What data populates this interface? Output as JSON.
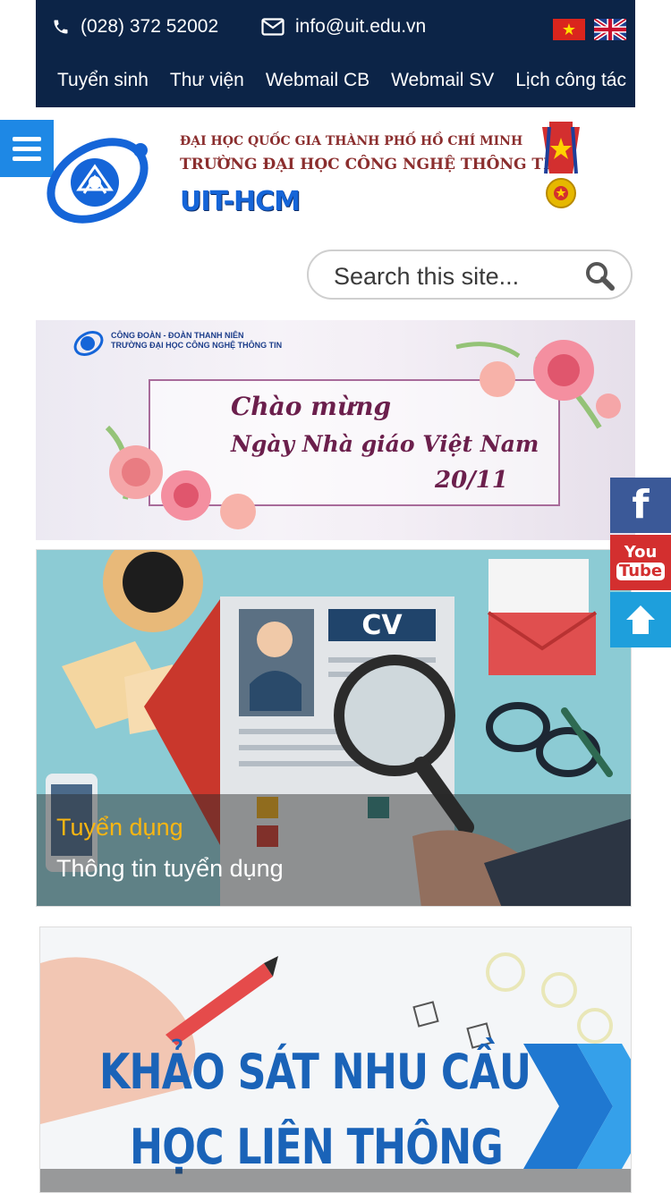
{
  "topbar": {
    "phone": "(028) 372 52002",
    "email": "info@uit.edu.vn",
    "links": [
      "Tuyển sinh",
      "Thư viện",
      "Webmail CB",
      "Webmail SV",
      "Lịch công tác"
    ]
  },
  "header": {
    "line1": "ĐẠI HỌC QUỐC GIA THÀNH PHỐ HỒ CHÍ MINH",
    "line2": "TRƯỜNG ĐẠI HỌC CÔNG NGHỆ THÔNG TIN",
    "line3": "UIT-HCM"
  },
  "search": {
    "placeholder": "Search this site..."
  },
  "banner": {
    "org_line1": "CÔNG ĐOÀN - ĐOÀN THANH NIÊN",
    "org_line2": "TRƯỜNG ĐẠI HỌC CÔNG NGHỆ THÔNG TIN",
    "line1": "Chào mừng",
    "line2": "Ngày Nhà giáo Việt Nam",
    "line3": "20/11"
  },
  "news": [
    {
      "category": "Tuyển dụng",
      "title": "Thông tin tuyển dụng",
      "image_text": "CV"
    },
    {
      "image_line1": "KHẢO SÁT NHU CẦU",
      "image_line2": "HỌC LIÊN THÔNG"
    }
  ],
  "side_buttons": {
    "facebook": "f",
    "youtube_top": "You",
    "youtube_bottom": "Tube"
  },
  "colors": {
    "topbar": "#0c2447",
    "accent_blue": "#1e88e5",
    "category": "#f9b612",
    "facebook": "#3b5998",
    "youtube": "#d32f2f",
    "scroll_top": "#1e9fdc"
  },
  "icons": [
    "phone-icon",
    "envelope-icon",
    "vietnam-flag-icon",
    "uk-flag-icon",
    "hamburger-icon",
    "search-icon",
    "facebook-icon",
    "youtube-icon",
    "arrow-up-icon"
  ]
}
